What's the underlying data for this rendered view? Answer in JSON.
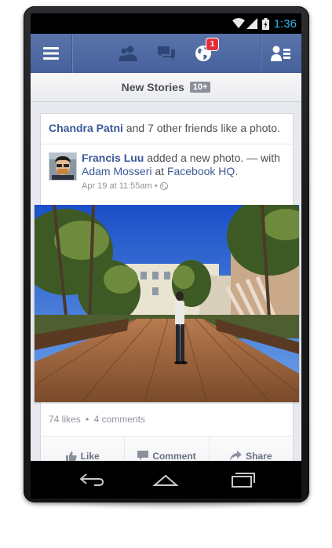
{
  "status_bar": {
    "time": "1:36"
  },
  "navbar": {
    "notification_count": "1"
  },
  "new_stories": {
    "label": "New Stories",
    "count": "10+"
  },
  "story": {
    "social_actor": "Chandra Patni",
    "social_text": " and 7 other friends like a photo.",
    "author": "Francis Luu",
    "action_text": " added a new photo. — with ",
    "tagged": "Adam Mosseri",
    "at_text": " at ",
    "place": "Facebook HQ",
    "end_text": ".",
    "timestamp": "Apr 19 at 11:55am",
    "likes": "74 likes",
    "comments": "4 comments"
  },
  "actions": {
    "like": "Like",
    "comment": "Comment",
    "share": "Share"
  },
  "colors": {
    "brand": "#3b5998",
    "navbar": "#4e69a2",
    "badge": "#e0303a",
    "clock": "#33b5e5"
  }
}
